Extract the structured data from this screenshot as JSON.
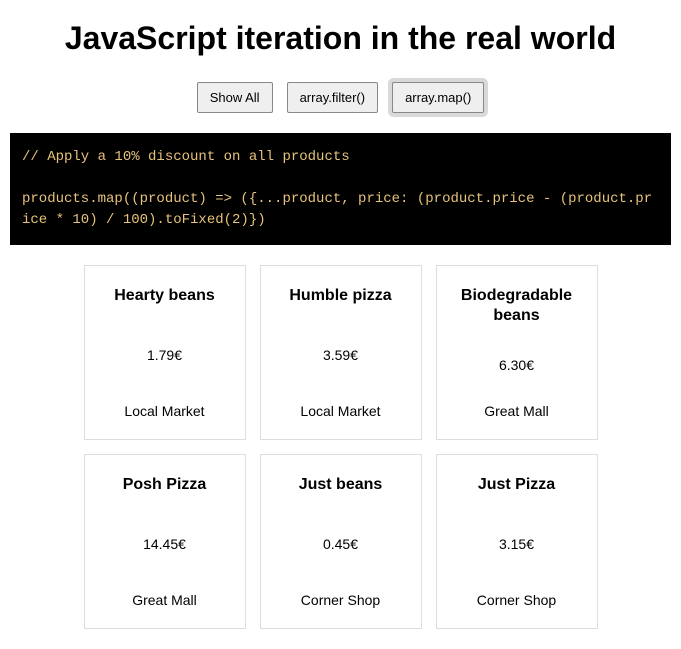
{
  "title": "JavaScript iteration in the real world",
  "buttons": {
    "show_all": "Show All",
    "filter": "array.filter()",
    "map": "array.map()"
  },
  "code": "// Apply a 10% discount on all products\n\nproducts.map((product) => ({...product, price: (product.price - (product.price * 10) / 100).toFixed(2)})",
  "currency": "€",
  "products": [
    {
      "name": "Hearty beans",
      "price": "1.79",
      "store": "Local Market"
    },
    {
      "name": "Humble pizza",
      "price": "3.59",
      "store": "Local Market"
    },
    {
      "name": "Biodegradable beans",
      "price": "6.30",
      "store": "Great Mall"
    },
    {
      "name": "Posh Pizza",
      "price": "14.45",
      "store": "Great Mall"
    },
    {
      "name": "Just beans",
      "price": "0.45",
      "store": "Corner Shop"
    },
    {
      "name": "Just Pizza",
      "price": "3.15",
      "store": "Corner Shop"
    }
  ]
}
